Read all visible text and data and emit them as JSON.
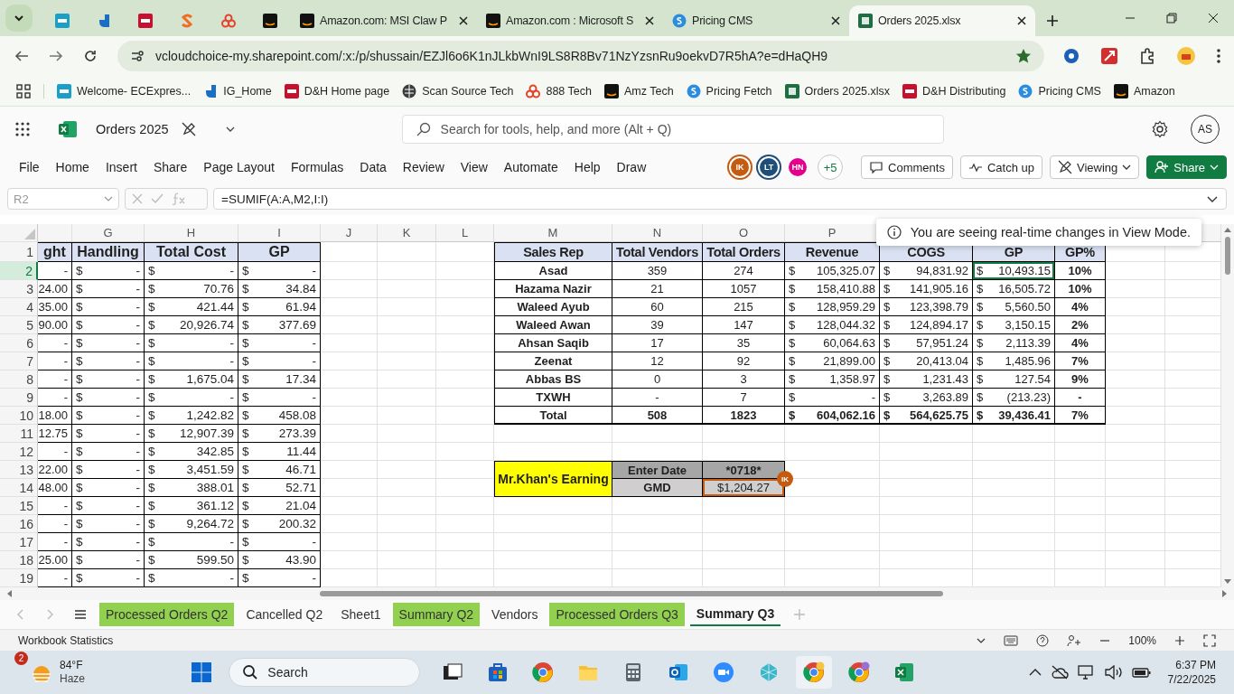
{
  "browser": {
    "tabs": [
      {
        "kind": "ec",
        "selected": false
      },
      {
        "kind": "ig",
        "selected": false
      },
      {
        "kind": "dh",
        "selected": false
      },
      {
        "kind": "ss",
        "selected": false
      },
      {
        "kind": "rings",
        "selected": false
      },
      {
        "kind": "amazon",
        "selected": false
      },
      {
        "kind": "amazon",
        "title": "Amazon.com: MSI Claw P",
        "selected": false
      },
      {
        "kind": "amazon",
        "title": "Amazon.com : Microsoft S",
        "selected": false
      },
      {
        "kind": "pricing",
        "title": "Pricing CMS",
        "selected": false
      },
      {
        "kind": "excel",
        "title": "Orders 2025.xlsx",
        "selected": true
      }
    ],
    "address": "vcloudchoice-my.sharepoint.com/:x:/p/shussain/EZJl6o6K1nJLkbWnI9LS8R8Bv71NzYzsnRu9oekvD7R5hA?e=dHaQH9",
    "bookmarks": [
      {
        "kind": "ec",
        "label": "Welcome- ECExpres..."
      },
      {
        "kind": "ig",
        "label": "IG_Home"
      },
      {
        "kind": "dh",
        "label": "D&H Home page"
      },
      {
        "kind": "globe",
        "label": "Scan Source Tech"
      },
      {
        "kind": "rings",
        "label": "888 Tech"
      },
      {
        "kind": "amazon",
        "label": "Amz Tech"
      },
      {
        "kind": "pricing",
        "label": "Pricing Fetch"
      },
      {
        "kind": "excel",
        "label": "Orders 2025.xlsx"
      },
      {
        "kind": "dh",
        "label": "D&H Distributing"
      },
      {
        "kind": "pricing",
        "label": "Pricing CMS"
      },
      {
        "kind": "amazon",
        "label": "Amazon"
      }
    ]
  },
  "app": {
    "file_name": "Orders 2025",
    "search_placeholder": "Search for tools, help, and more (Alt + Q)",
    "user_initials": "AS"
  },
  "menu": [
    "File",
    "Home",
    "Insert",
    "Share",
    "Page Layout",
    "Formulas",
    "Data",
    "Review",
    "View",
    "Automate",
    "Help",
    "Draw"
  ],
  "presence": [
    {
      "initials": "IK",
      "color": "#c55a11"
    },
    {
      "initials": "LT",
      "color": "#1f4e79"
    },
    {
      "initials": "HN",
      "color": "#e3008c"
    }
  ],
  "presence_more": "+5",
  "actions": [
    {
      "kind": "comments",
      "label": "Comments"
    },
    {
      "kind": "catchup",
      "label": "Catch up"
    },
    {
      "kind": "viewing",
      "label": "Viewing"
    },
    {
      "kind": "share",
      "label": "Share"
    }
  ],
  "formula_bar": {
    "name_box": "R2",
    "formula": "=SUMIF(A:A,M2,I:I)"
  },
  "sheet": {
    "column_headers": [
      "G",
      "H",
      "I",
      "J",
      "K",
      "L",
      "M",
      "N",
      "O",
      "P"
    ],
    "row_numbers": [
      {
        "label": "1",
        "selected": false
      },
      {
        "label": "2",
        "selected": true
      },
      {
        "label": "3",
        "selected": false
      },
      {
        "label": "4",
        "selected": false
      },
      {
        "label": "5",
        "selected": false
      },
      {
        "label": "6",
        "selected": false
      },
      {
        "label": "7",
        "selected": false
      },
      {
        "label": "8",
        "selected": false
      },
      {
        "label": "9",
        "selected": false
      },
      {
        "label": "10",
        "selected": false
      },
      {
        "label": "11",
        "selected": false
      },
      {
        "label": "12",
        "selected": false
      },
      {
        "label": "13",
        "selected": false
      },
      {
        "label": "14",
        "selected": false
      },
      {
        "label": "15",
        "selected": false
      },
      {
        "label": "16",
        "selected": false
      },
      {
        "label": "17",
        "selected": false
      },
      {
        "label": "18",
        "selected": false
      },
      {
        "label": "19",
        "selected": false
      }
    ]
  },
  "left_table": {
    "columns": [
      "ght",
      "Handling",
      "Total Cost",
      "GP"
    ],
    "rows": [
      [
        "-",
        [
          "$",
          "-"
        ],
        [
          "$",
          "-"
        ],
        [
          "$",
          "-"
        ]
      ],
      [
        "24.00",
        [
          "$",
          "-"
        ],
        [
          "$",
          "70.76"
        ],
        [
          "$",
          "34.84"
        ]
      ],
      [
        "35.00",
        [
          "$",
          "-"
        ],
        [
          "$",
          "421.44"
        ],
        [
          "$",
          "61.94"
        ]
      ],
      [
        "90.00",
        [
          "$",
          "-"
        ],
        [
          "$",
          "20,926.74"
        ],
        [
          "$",
          "377.69"
        ]
      ],
      [
        "-",
        [
          "$",
          "-"
        ],
        [
          "$",
          "-"
        ],
        [
          "$",
          "-"
        ]
      ],
      [
        "-",
        [
          "$",
          "-"
        ],
        [
          "$",
          "-"
        ],
        [
          "$",
          "-"
        ]
      ],
      [
        "-",
        [
          "$",
          "-"
        ],
        [
          "$",
          "1,675.04"
        ],
        [
          "$",
          "17.34"
        ]
      ],
      [
        "-",
        [
          "$",
          "-"
        ],
        [
          "$",
          "-"
        ],
        [
          "$",
          "-"
        ]
      ],
      [
        "18.00",
        [
          "$",
          "-"
        ],
        [
          "$",
          "1,242.82"
        ],
        [
          "$",
          "458.08"
        ]
      ],
      [
        "12.75",
        [
          "$",
          "-"
        ],
        [
          "$",
          "12,907.39"
        ],
        [
          "$",
          "273.39"
        ]
      ],
      [
        "-",
        [
          "$",
          "-"
        ],
        [
          "$",
          "342.85"
        ],
        [
          "$",
          "11.44"
        ]
      ],
      [
        "22.00",
        [
          "$",
          "-"
        ],
        [
          "$",
          "3,451.59"
        ],
        [
          "$",
          "46.71"
        ]
      ],
      [
        "48.00",
        [
          "$",
          "-"
        ],
        [
          "$",
          "388.01"
        ],
        [
          "$",
          "52.71"
        ]
      ],
      [
        "-",
        [
          "$",
          "-"
        ],
        [
          "$",
          "361.12"
        ],
        [
          "$",
          "21.04"
        ]
      ],
      [
        "-",
        [
          "$",
          "-"
        ],
        [
          "$",
          "9,264.72"
        ],
        [
          "$",
          "200.32"
        ]
      ],
      [
        "-",
        [
          "$",
          "-"
        ],
        [
          "$",
          "-"
        ],
        [
          "$",
          "-"
        ]
      ],
      [
        "25.00",
        [
          "$",
          "-"
        ],
        [
          "$",
          "599.50"
        ],
        [
          "$",
          "43.90"
        ]
      ],
      [
        "-",
        [
          "$",
          "-"
        ],
        [
          "$",
          "-"
        ],
        [
          "$",
          "-"
        ]
      ]
    ]
  },
  "right_table": {
    "columns": [
      "Sales Rep",
      "Total Vendors",
      "Total Orders",
      "Revenue",
      "COGS",
      "GP",
      "GP%"
    ],
    "rows": [
      {
        "kind": "data",
        "selected": true,
        "cells": [
          "Asad",
          "359",
          "274",
          [
            "$",
            "105,325.07"
          ],
          [
            "$",
            "94,831.92"
          ],
          [
            "$",
            "10,493.15"
          ],
          "10%"
        ]
      },
      {
        "kind": "data",
        "selected": false,
        "cells": [
          "Hazama Nazir",
          "21",
          "1057",
          [
            "$",
            "158,410.88"
          ],
          [
            "$",
            "141,905.16"
          ],
          [
            "$",
            "16,505.72"
          ],
          "10%"
        ]
      },
      {
        "kind": "data",
        "selected": false,
        "cells": [
          "Waleed Ayub",
          "60",
          "215",
          [
            "$",
            "128,959.29"
          ],
          [
            "$",
            "123,398.79"
          ],
          [
            "$",
            "5,560.50"
          ],
          "4%"
        ]
      },
      {
        "kind": "data",
        "selected": false,
        "cells": [
          "Waleed Awan",
          "39",
          "147",
          [
            "$",
            "128,044.32"
          ],
          [
            "$",
            "124,894.17"
          ],
          [
            "$",
            "3,150.15"
          ],
          "2%"
        ]
      },
      {
        "kind": "data",
        "selected": false,
        "cells": [
          "Ahsan Saqib",
          "17",
          "35",
          [
            "$",
            "60,064.63"
          ],
          [
            "$",
            "57,951.24"
          ],
          [
            "$",
            "2,113.39"
          ],
          "4%"
        ]
      },
      {
        "kind": "data",
        "selected": false,
        "cells": [
          "Zeenat",
          "12",
          "92",
          [
            "$",
            "21,899.00"
          ],
          [
            "$",
            "20,413.04"
          ],
          [
            "$",
            "1,485.96"
          ],
          "7%"
        ]
      },
      {
        "kind": "data",
        "selected": false,
        "cells": [
          "Abbas BS",
          "0",
          "3",
          [
            "$",
            "1,358.97"
          ],
          [
            "$",
            "1,231.43"
          ],
          [
            "$",
            "127.54"
          ],
          "9%"
        ]
      },
      {
        "kind": "data",
        "selected": false,
        "cells": [
          "TXWH",
          "-",
          "7",
          [
            "$",
            "-"
          ],
          [
            "$",
            "3,263.89"
          ],
          [
            "$",
            "(213.23)"
          ],
          "-"
        ]
      },
      {
        "kind": "total",
        "selected": false,
        "cells": [
          "Total",
          "508",
          "1823",
          [
            "$",
            "604,062.16"
          ],
          [
            "$",
            "564,625.75"
          ],
          [
            "$",
            "39,436.41"
          ],
          "7%"
        ]
      }
    ]
  },
  "earnings": {
    "label": "Mr.Khan's Earning",
    "date_label": "Enter Date",
    "date_value": "*0718*",
    "result_label": "GMD",
    "result_value": "$1,204.27",
    "collaborator": "IK"
  },
  "toast": "You are seeing real-time changes in View Mode.",
  "sheet_tabs": [
    {
      "label": "Processed Orders Q2",
      "color": "#92d050",
      "selected": false
    },
    {
      "label": "Cancelled Q2",
      "selected": false
    },
    {
      "label": "Sheet1",
      "selected": false
    },
    {
      "label": "Summary Q2",
      "color": "#92d050",
      "selected": false
    },
    {
      "label": "Vendors",
      "selected": false
    },
    {
      "label": "Processed Orders Q3",
      "color": "#92d050",
      "selected": false
    },
    {
      "label": "Summary Q3",
      "selected": true
    }
  ],
  "status_bar": {
    "left": "Workbook Statistics",
    "zoom": "100%"
  },
  "taskbar": {
    "temperature": "84°F",
    "condition": "Haze",
    "badge": "2",
    "search": "Search",
    "time": "6:37 PM",
    "date": "7/22/2025"
  }
}
